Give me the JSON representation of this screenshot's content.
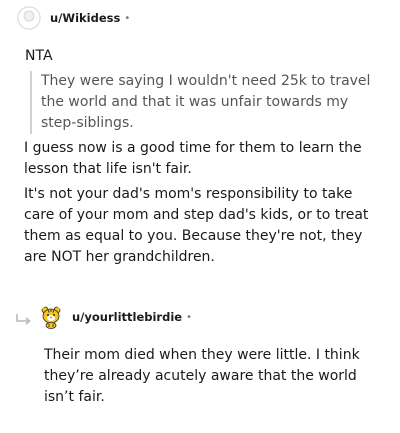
{
  "comment1": {
    "username": "u/Wikidess",
    "dot": "•",
    "paragraphs": [
      "NTA",
      "I guess now is a good time for them to learn the lesson that life isn't fair.",
      "It's not your dad's mom's responsibility to take care of your mom and step dad's kids, or to treat them as equal to you. Because they're not, they are NOT her grandchildren."
    ],
    "quote": "They were saying I wouldn't need 25k to travel the world and that it was unfair towards my step-siblings."
  },
  "comment2": {
    "username": "u/yourlittlebirdie",
    "dot": "•",
    "paragraphs": [
      "Their mom died when they were little. I think they’re already acutely aware that the world isn’t fair."
    ]
  }
}
